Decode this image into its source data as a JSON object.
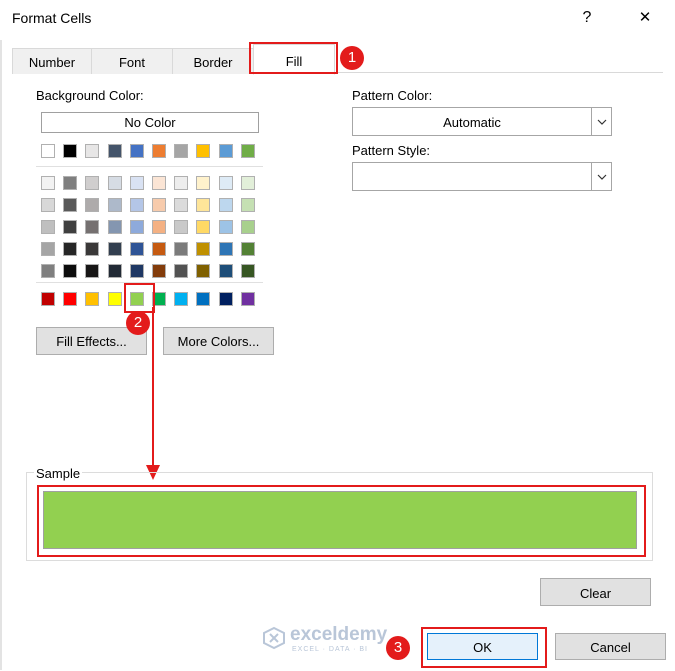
{
  "window": {
    "title": "Format Cells",
    "help_label": "?",
    "close_label": "✕"
  },
  "tabs": [
    {
      "label": "Number"
    },
    {
      "label": "Font"
    },
    {
      "label": "Border"
    },
    {
      "label": "Fill"
    }
  ],
  "active_tab": "Fill",
  "fill": {
    "background_color_label": "Background Color:",
    "no_color_label": "No Color",
    "pattern_color_label": "Pattern Color:",
    "pattern_color_value": "Automatic",
    "pattern_style_label": "Pattern Style:",
    "pattern_style_value": "",
    "fill_effects_label": "Fill Effects...",
    "more_colors_label": "More Colors...",
    "sample_label": "Sample",
    "selected_color": "#92d050",
    "clear_label": "Clear"
  },
  "palette": {
    "theme_top": [
      "#ffffff",
      "#000000",
      "#e7e6e6",
      "#44546a",
      "#4472c4",
      "#ed7d31",
      "#a5a5a5",
      "#ffc000",
      "#5b9bd5",
      "#70ad47"
    ],
    "theme_shades": [
      [
        "#f2f2f2",
        "#7f7f7f",
        "#d0cece",
        "#d6dce4",
        "#d9e2f3",
        "#fbe5d5",
        "#ededed",
        "#fff2cc",
        "#deebf6",
        "#e2efd9"
      ],
      [
        "#d8d8d8",
        "#595959",
        "#aeabab",
        "#adb9ca",
        "#b4c6e7",
        "#f7cbac",
        "#dbdbdb",
        "#fee599",
        "#bdd7ee",
        "#c5e0b3"
      ],
      [
        "#bfbfbf",
        "#3f3f3f",
        "#757070",
        "#8496b0",
        "#8eaadb",
        "#f4b183",
        "#c9c9c9",
        "#ffd965",
        "#9dc3e6",
        "#a8d08d"
      ],
      [
        "#a5a5a5",
        "#262626",
        "#3a3838",
        "#323f4f",
        "#2f5496",
        "#c55a11",
        "#7b7b7b",
        "#bf9000",
        "#2e75b5",
        "#538135"
      ],
      [
        "#7f7f7f",
        "#0c0c0c",
        "#171616",
        "#222a35",
        "#1f3864",
        "#833c0b",
        "#525252",
        "#7f6000",
        "#1e4e79",
        "#375623"
      ]
    ],
    "standard": [
      "#c00000",
      "#ff0000",
      "#ffc000",
      "#ffff00",
      "#92d050",
      "#00b050",
      "#00b0f0",
      "#0070c0",
      "#002060",
      "#7030a0"
    ],
    "selected_standard_index": 4
  },
  "annotations": {
    "step1": "1",
    "step2": "2",
    "step3": "3",
    "color": "#e31b1b"
  },
  "footer": {
    "ok_label": "OK",
    "cancel_label": "Cancel"
  },
  "watermark": {
    "brand": "exceldemy",
    "tagline": "EXCEL · DATA · BI"
  }
}
